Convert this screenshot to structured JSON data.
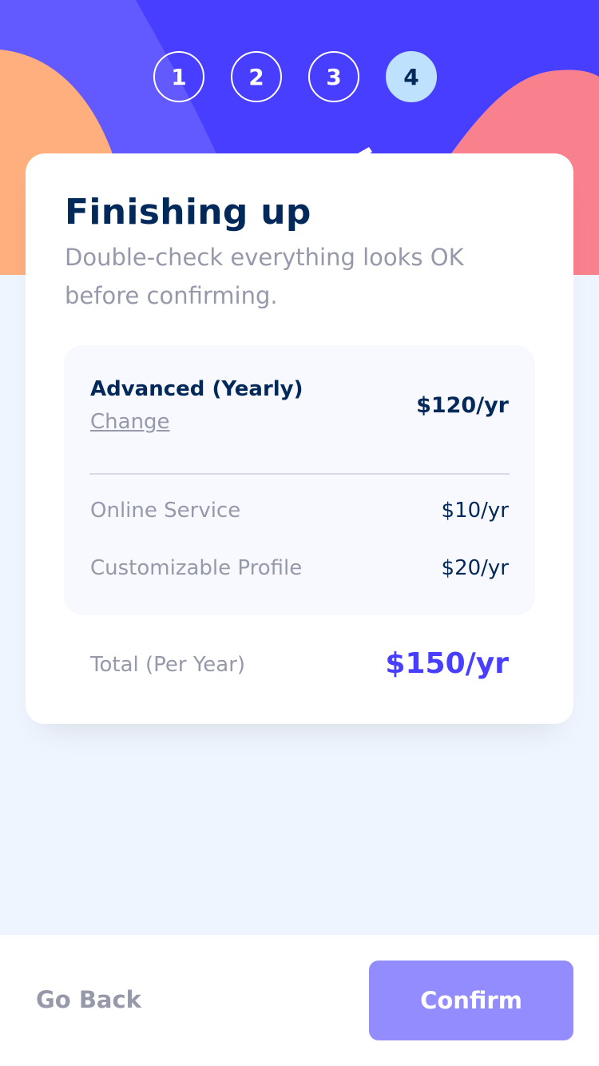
{
  "steps": [
    {
      "number": "1",
      "active": false
    },
    {
      "number": "2",
      "active": false
    },
    {
      "number": "3",
      "active": false
    },
    {
      "number": "4",
      "active": true
    }
  ],
  "header": {
    "title": "Finishing up",
    "subtitle": "Double-check everything looks OK before confirming."
  },
  "summary": {
    "plan_name": "Advanced (Yearly)",
    "change_label": "Change",
    "plan_price": "$120/yr",
    "addons": [
      {
        "name": "Online Service",
        "price": "$10/yr"
      },
      {
        "name": "Customizable Profile",
        "price": "$20/yr"
      }
    ]
  },
  "total": {
    "label": "Total (Per Year)",
    "price": "$150/yr"
  },
  "footer": {
    "back_label": "Go Back",
    "confirm_label": "Confirm"
  },
  "colors": {
    "primary": "#483eff",
    "marine_blue": "#022959",
    "light_blue": "#bee2fd",
    "grey": "#9699aa",
    "confirm_button": "#928cff",
    "orange_blob": "#ffaf7e",
    "pink_blob": "#f9818e"
  }
}
